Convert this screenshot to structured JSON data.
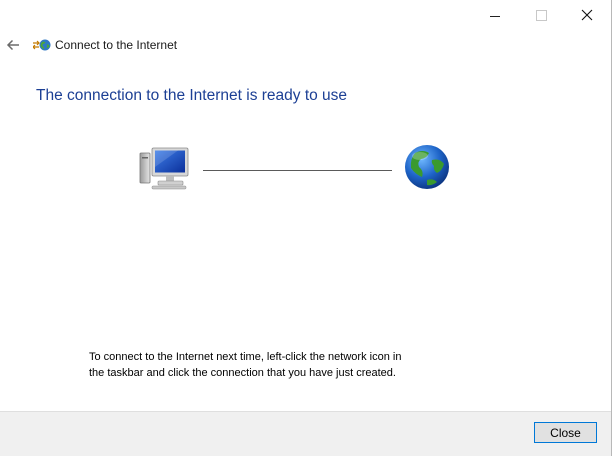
{
  "window": {
    "title": "Connect to the Internet"
  },
  "content": {
    "heading": "The connection to the Internet is ready to use",
    "info_text": "To connect to the Internet next time, left-click the network icon in\nthe taskbar and click the connection that you have just created."
  },
  "footer": {
    "close_label": "Close"
  },
  "icons": {
    "back": "back-arrow-icon",
    "app": "network-globe-icon",
    "computer": "computer-icon",
    "internet": "globe-icon",
    "minimize": "minimize-icon",
    "maximize": "maximize-icon",
    "close": "close-icon"
  },
  "colors": {
    "heading": "#1c3f94",
    "footer_bg": "#f0f0f0",
    "button_border": "#0078d7"
  }
}
